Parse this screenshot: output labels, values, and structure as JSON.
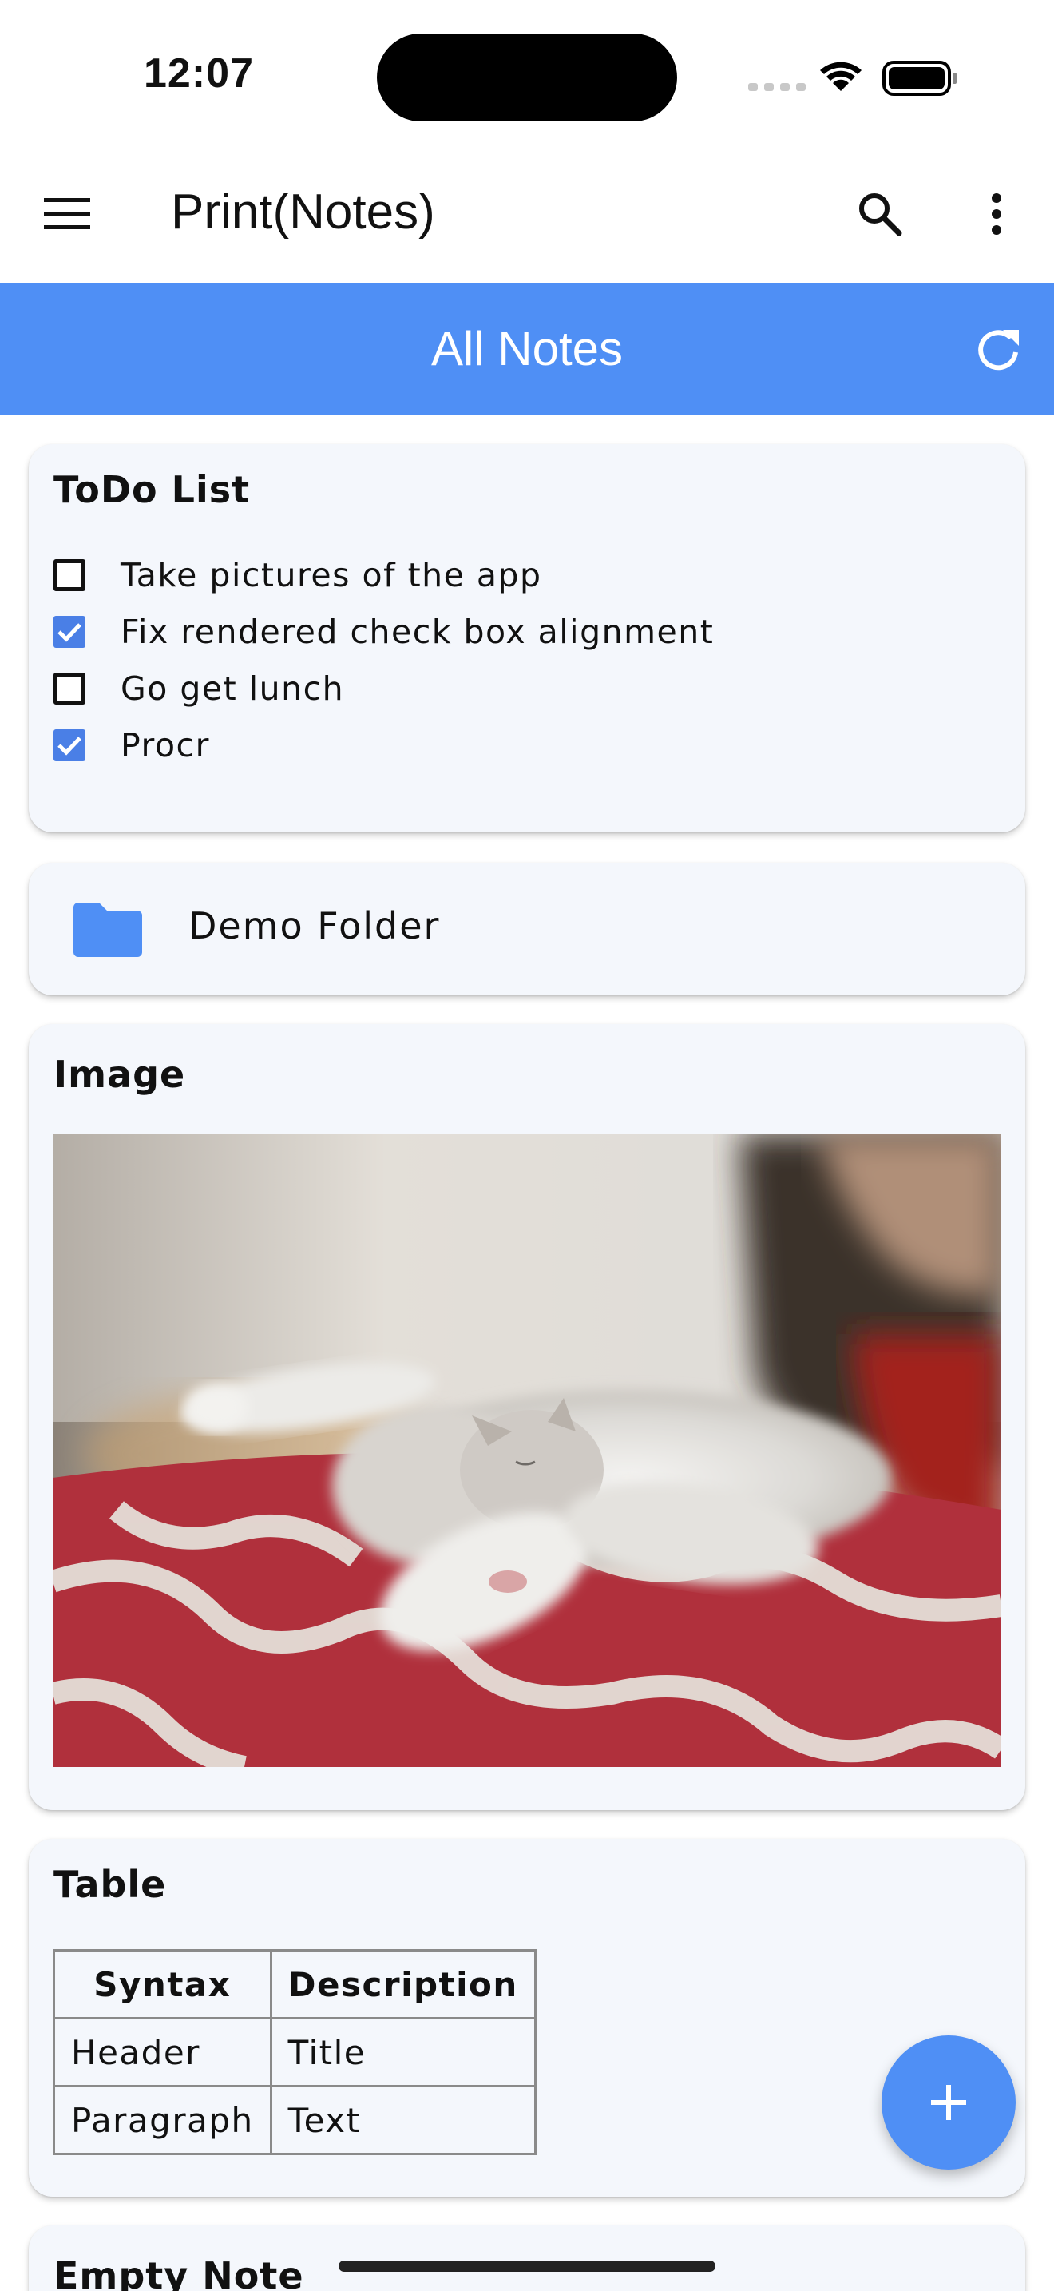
{
  "status_bar": {
    "time": "12:07"
  },
  "app_bar": {
    "title": "Print(Notes)"
  },
  "sub_bar": {
    "title": "All Notes"
  },
  "notes": {
    "todo": {
      "title": "ToDo List",
      "items": [
        {
          "label": "Take pictures of the app",
          "checked": false
        },
        {
          "label": "Fix rendered check box alignment",
          "checked": true
        },
        {
          "label": "Go get lunch",
          "checked": false
        },
        {
          "label": "Procr",
          "checked": true
        }
      ]
    },
    "folder": {
      "label": "Demo Folder"
    },
    "image": {
      "title": "Image"
    },
    "table": {
      "title": "Table",
      "headers": [
        "Syntax",
        "Description"
      ],
      "rows": [
        [
          "Header",
          "Title"
        ],
        [
          "Paragraph",
          "Text"
        ]
      ]
    },
    "empty": {
      "title": "Empty Note"
    }
  },
  "colors": {
    "accent": "#4f8ff5",
    "checkbox": "#4a7fe6",
    "card_bg": "#f4f7fc"
  },
  "icons": {
    "menu": "hamburger-menu-icon",
    "search": "search-icon",
    "more": "more-vert-icon",
    "refresh": "refresh-icon",
    "folder": "folder-icon",
    "add": "plus-icon"
  }
}
